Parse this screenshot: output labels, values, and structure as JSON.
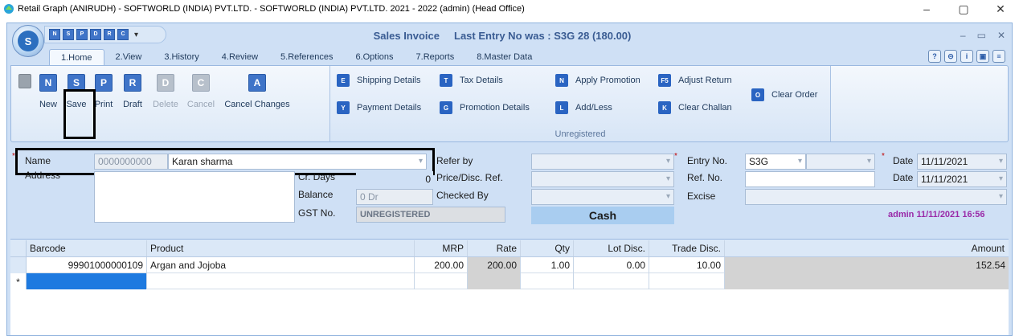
{
  "os": {
    "title": "Retail Graph (ANIRUDH) - SOFTWORLD (INDIA) PVT.LTD. - SOFTWORLD (INDIA) PVT.LTD.  2021 - 2022 (admin) (Head Office)",
    "minimize": "–",
    "maximize": "▢",
    "close": "✕"
  },
  "app": {
    "orb_letter": "S",
    "title": "Sales Invoice",
    "last_entry": "Last Entry No was : S3G 28  (180.00)",
    "win_min": "–",
    "win_max": "▭",
    "win_close": "✕",
    "qat_more": "▾",
    "qat_icons": [
      "N",
      "S",
      "P",
      "D",
      "R",
      "C"
    ]
  },
  "tabs": [
    "1.Home",
    "2.View",
    "3.History",
    "4.Review",
    "5.References",
    "6.Options",
    "7.Reports",
    "8.Master Data"
  ],
  "right_icons": [
    "?",
    "⊝",
    "i",
    "▣",
    "≡"
  ],
  "ribbon": {
    "buttons": [
      {
        "label": "New",
        "icon": "N"
      },
      {
        "label": "Save",
        "icon": "S"
      },
      {
        "label": "Print",
        "icon": "P"
      },
      {
        "label": "Draft",
        "icon": "R"
      },
      {
        "label": "Delete",
        "icon": "D"
      },
      {
        "label": "Cancel",
        "icon": "C"
      },
      {
        "label": "Cancel Changes",
        "icon": "A"
      }
    ],
    "group2": {
      "label": "Unregistered",
      "items": [
        {
          "label": "Shipping Details",
          "icon": "E"
        },
        {
          "label": "Tax Details",
          "icon": "T"
        },
        {
          "label": "Apply Promotion",
          "icon": "N"
        },
        {
          "label": "Adjust Return",
          "icon": "F5"
        },
        {
          "label": "Payment Details",
          "icon": "Y"
        },
        {
          "label": "Promotion Details",
          "icon": "G"
        },
        {
          "label": "Add/Less",
          "icon": "L"
        },
        {
          "label": "Clear Challan",
          "icon": "K"
        },
        {
          "label": "Clear Order",
          "icon": "O"
        }
      ]
    }
  },
  "form": {
    "name_label": "Name",
    "name_code": "0000000000",
    "name_value": "Karan sharma",
    "address_label": "Address",
    "cr_days_label": "Cr. Days",
    "cr_days_value": "0",
    "balance_label": "Balance",
    "balance_value": "0 Dr",
    "gst_label": "GST No.",
    "gst_value": "UNREGISTERED",
    "refer_by_label": "Refer by",
    "price_ref_label": "Price/Disc. Ref.",
    "checked_by_label": "Checked By",
    "payment_mode": "Cash",
    "entry_no_label": "Entry No.",
    "entry_no_value": "S3G",
    "ref_no_label": "Ref. No.",
    "excise_label": "Excise",
    "date_label": "Date",
    "date_value": "11/11/2021",
    "date2_label": "Date",
    "date2_value": "11/11/2021",
    "user_stamp": "admin 11/11/2021 16:56",
    "required_mark": "*"
  },
  "grid": {
    "headers": [
      "Barcode",
      "Product",
      "MRP",
      "Rate",
      "Qty",
      "Lot Disc.",
      "Trade Disc.",
      "Amount"
    ],
    "rows": [
      [
        "99901000000109",
        "Argan and Jojoba",
        "200.00",
        "200.00",
        "1.00",
        "0.00",
        "10.00",
        "152.54"
      ]
    ],
    "new_row_marker": "*"
  }
}
